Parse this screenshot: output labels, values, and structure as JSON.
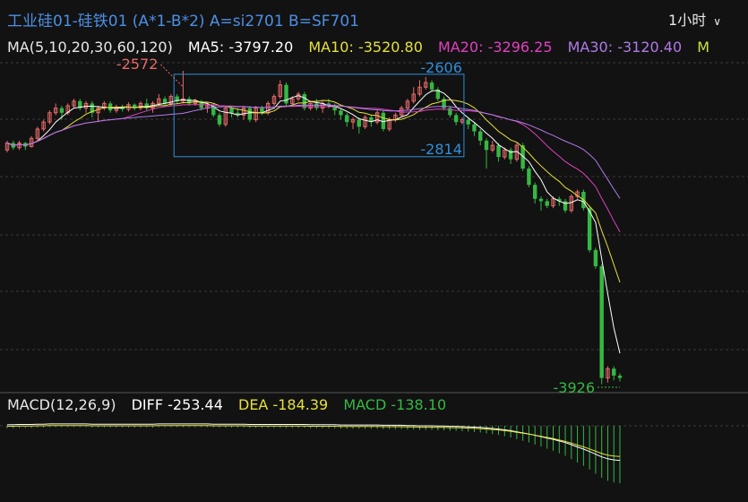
{
  "header": {
    "title": "工业硅01-硅铁01 (A*1-B*2) A=si2701 B=SF701",
    "period": "1小时"
  },
  "colors": {
    "up": "#e86a6a",
    "down": "#35b843",
    "ma5": "#ffffff",
    "ma10": "#e6e03a",
    "ma20": "#e040c0",
    "ma30": "#b07ae8",
    "ma60": "#c8e43c",
    "grid": "#3a3a3a",
    "box": "#2f8fd8",
    "diff": "#ffffff",
    "dea": "#e6e03a",
    "macd_label": "#35b843"
  },
  "ma_legend": {
    "prefix": "MA(5,10,20,30,60,120)",
    "ma5": "MA5: -3797.20",
    "ma10": "MA10: -3520.80",
    "ma20": "MA20: -3296.25",
    "ma30": "MA30: -3120.40",
    "ma60": "M"
  },
  "macd_legend": {
    "prefix": "MACD(12,26,9)",
    "diff": "DIFF -253.44",
    "dea": "DEA -184.39",
    "macd": "MACD -138.10"
  },
  "chart_data": {
    "type": "candlestick",
    "ylim": [
      -3940,
      -2545
    ],
    "annotations": {
      "high": "-2572",
      "box_top": "-2606",
      "box_bottom": "-2814",
      "low": "-3926"
    },
    "candles": [
      [
        -2920,
        -2890,
        -2880,
        -2930
      ],
      [
        -2890,
        -2910,
        -2880,
        -2920
      ],
      [
        -2910,
        -2890,
        -2880,
        -2920
      ],
      [
        -2890,
        -2905,
        -2885,
        -2920
      ],
      [
        -2905,
        -2870,
        -2860,
        -2910
      ],
      [
        -2870,
        -2830,
        -2820,
        -2880
      ],
      [
        -2830,
        -2800,
        -2790,
        -2840
      ],
      [
        -2800,
        -2760,
        -2750,
        -2810
      ],
      [
        -2760,
        -2740,
        -2720,
        -2770
      ],
      [
        -2740,
        -2760,
        -2730,
        -2790
      ],
      [
        -2760,
        -2730,
        -2720,
        -2770
      ],
      [
        -2730,
        -2710,
        -2700,
        -2740
      ],
      [
        -2710,
        -2740,
        -2700,
        -2750
      ],
      [
        -2740,
        -2720,
        -2710,
        -2760
      ],
      [
        -2720,
        -2760,
        -2710,
        -2780
      ],
      [
        -2760,
        -2740,
        -2730,
        -2800
      ],
      [
        -2740,
        -2720,
        -2710,
        -2750
      ],
      [
        -2720,
        -2750,
        -2710,
        -2760
      ],
      [
        -2750,
        -2735,
        -2725,
        -2760
      ],
      [
        -2735,
        -2745,
        -2725,
        -2755
      ],
      [
        -2745,
        -2725,
        -2715,
        -2755
      ],
      [
        -2725,
        -2740,
        -2720,
        -2750
      ],
      [
        -2740,
        -2720,
        -2710,
        -2750
      ],
      [
        -2720,
        -2740,
        -2700,
        -2750
      ],
      [
        -2740,
        -2720,
        -2710,
        -2760
      ],
      [
        -2720,
        -2700,
        -2680,
        -2730
      ],
      [
        -2700,
        -2720,
        -2690,
        -2730
      ],
      [
        -2720,
        -2690,
        -2680,
        -2730
      ],
      [
        -2690,
        -2710,
        -2680,
        -2720
      ],
      [
        -2710,
        -2700,
        -2580,
        -2720
      ],
      [
        -2700,
        -2720,
        -2690,
        -2730
      ],
      [
        -2720,
        -2710,
        -2700,
        -2730
      ],
      [
        -2710,
        -2740,
        -2705,
        -2750
      ],
      [
        -2740,
        -2730,
        -2720,
        -2760
      ],
      [
        -2730,
        -2770,
        -2720,
        -2780
      ],
      [
        -2770,
        -2810,
        -2760,
        -2820
      ],
      [
        -2810,
        -2740,
        -2730,
        -2820
      ],
      [
        -2740,
        -2760,
        -2730,
        -2780
      ],
      [
        -2760,
        -2770,
        -2740,
        -2780
      ],
      [
        -2770,
        -2740,
        -2730,
        -2790
      ],
      [
        -2740,
        -2790,
        -2730,
        -2800
      ],
      [
        -2790,
        -2740,
        -2730,
        -2800
      ],
      [
        -2740,
        -2760,
        -2730,
        -2770
      ],
      [
        -2760,
        -2720,
        -2710,
        -2770
      ],
      [
        -2720,
        -2690,
        -2680,
        -2730
      ],
      [
        -2690,
        -2640,
        -2620,
        -2700
      ],
      [
        -2640,
        -2720,
        -2630,
        -2730
      ],
      [
        -2720,
        -2700,
        -2690,
        -2730
      ],
      [
        -2700,
        -2680,
        -2670,
        -2710
      ],
      [
        -2680,
        -2740,
        -2670,
        -2750
      ],
      [
        -2740,
        -2720,
        -2710,
        -2750
      ],
      [
        -2720,
        -2740,
        -2700,
        -2750
      ],
      [
        -2740,
        -2720,
        -2710,
        -2760
      ],
      [
        -2720,
        -2730,
        -2700,
        -2740
      ],
      [
        -2730,
        -2750,
        -2720,
        -2770
      ],
      [
        -2750,
        -2770,
        -2740,
        -2790
      ],
      [
        -2770,
        -2800,
        -2760,
        -2820
      ],
      [
        -2800,
        -2790,
        -2780,
        -2830
      ],
      [
        -2790,
        -2820,
        -2780,
        -2850
      ],
      [
        -2820,
        -2780,
        -2770,
        -2830
      ],
      [
        -2780,
        -2800,
        -2770,
        -2820
      ],
      [
        -2800,
        -2760,
        -2750,
        -2810
      ],
      [
        -2760,
        -2830,
        -2750,
        -2840
      ],
      [
        -2830,
        -2790,
        -2780,
        -2840
      ],
      [
        -2790,
        -2770,
        -2760,
        -2800
      ],
      [
        -2770,
        -2740,
        -2730,
        -2780
      ],
      [
        -2740,
        -2710,
        -2700,
        -2750
      ],
      [
        -2710,
        -2680,
        -2650,
        -2720
      ],
      [
        -2680,
        -2650,
        -2620,
        -2690
      ],
      [
        -2650,
        -2630,
        -2606,
        -2660
      ],
      [
        -2630,
        -2660,
        -2620,
        -2670
      ],
      [
        -2660,
        -2700,
        -2650,
        -2710
      ],
      [
        -2700,
        -2740,
        -2690,
        -2750
      ],
      [
        -2740,
        -2770,
        -2730,
        -2780
      ],
      [
        -2770,
        -2800,
        -2760,
        -2814
      ],
      [
        -2800,
        -2790,
        -2780,
        -2810
      ],
      [
        -2790,
        -2810,
        -2780,
        -2830
      ],
      [
        -2810,
        -2840,
        -2800,
        -2860
      ],
      [
        -2840,
        -2880,
        -2830,
        -2900
      ],
      [
        -2880,
        -2920,
        -2870,
        -3000
      ],
      [
        -2920,
        -2900,
        -2880,
        -2930
      ],
      [
        -2900,
        -2950,
        -2890,
        -2970
      ],
      [
        -2950,
        -2920,
        -2910,
        -2960
      ],
      [
        -2920,
        -2960,
        -2910,
        -2980
      ],
      [
        -2960,
        -2900,
        -2890,
        -2970
      ],
      [
        -2900,
        -3000,
        -2890,
        -3010
      ],
      [
        -3000,
        -3070,
        -2990,
        -3080
      ],
      [
        -3070,
        -3130,
        -3060,
        -3150
      ],
      [
        -3130,
        -3140,
        -3120,
        -3180
      ],
      [
        -3140,
        -3160,
        -3130,
        -3170
      ],
      [
        -3160,
        -3130,
        -3120,
        -3170
      ],
      [
        -3130,
        -3140,
        -3120,
        -3160
      ],
      [
        -3140,
        -3180,
        -3130,
        -3190
      ],
      [
        -3180,
        -3120,
        -3110,
        -3190
      ],
      [
        -3120,
        -3100,
        -3090,
        -3130
      ],
      [
        -3100,
        -3170,
        -3090,
        -3180
      ],
      [
        -3170,
        -3350,
        -3160,
        -3360
      ],
      [
        -3350,
        -3420,
        -3340,
        -3430
      ],
      [
        -3420,
        -3900,
        -3410,
        -3926
      ],
      [
        -3900,
        -3860,
        -3850,
        -3920
      ],
      [
        -3860,
        -3890,
        -3850,
        -3910
      ],
      [
        -3890,
        -3900,
        -3880,
        -3915
      ]
    ],
    "macd_hist": [
      -6,
      -6,
      -5,
      -5,
      -5,
      -4,
      -4,
      -3,
      -3,
      -3,
      -3,
      -3,
      -3,
      -3,
      -4,
      -4,
      -4,
      -4,
      -4,
      -4,
      -4,
      -4,
      -4,
      -4,
      -4,
      -3,
      -3,
      -3,
      -3,
      -3,
      -3,
      -3,
      -3,
      -3,
      -4,
      -4,
      -4,
      -4,
      -4,
      -4,
      -5,
      -5,
      -5,
      -5,
      -5,
      -5,
      -5,
      -5,
      -5,
      -5,
      -6,
      -6,
      -6,
      -6,
      -6,
      -7,
      -7,
      -7,
      -7,
      -7,
      -7,
      -7,
      -8,
      -8,
      -8,
      -8,
      -9,
      -9,
      -10,
      -10,
      -10,
      -11,
      -11,
      -12,
      -12,
      -13,
      -14,
      -15,
      -16,
      -18,
      -20,
      -22,
      -25,
      -28,
      -32,
      -36,
      -40,
      -45,
      -50,
      -55,
      -60,
      -66,
      -72,
      -80,
      -88,
      -96,
      -105,
      -115,
      -125,
      -132,
      -136,
      -138
    ]
  }
}
